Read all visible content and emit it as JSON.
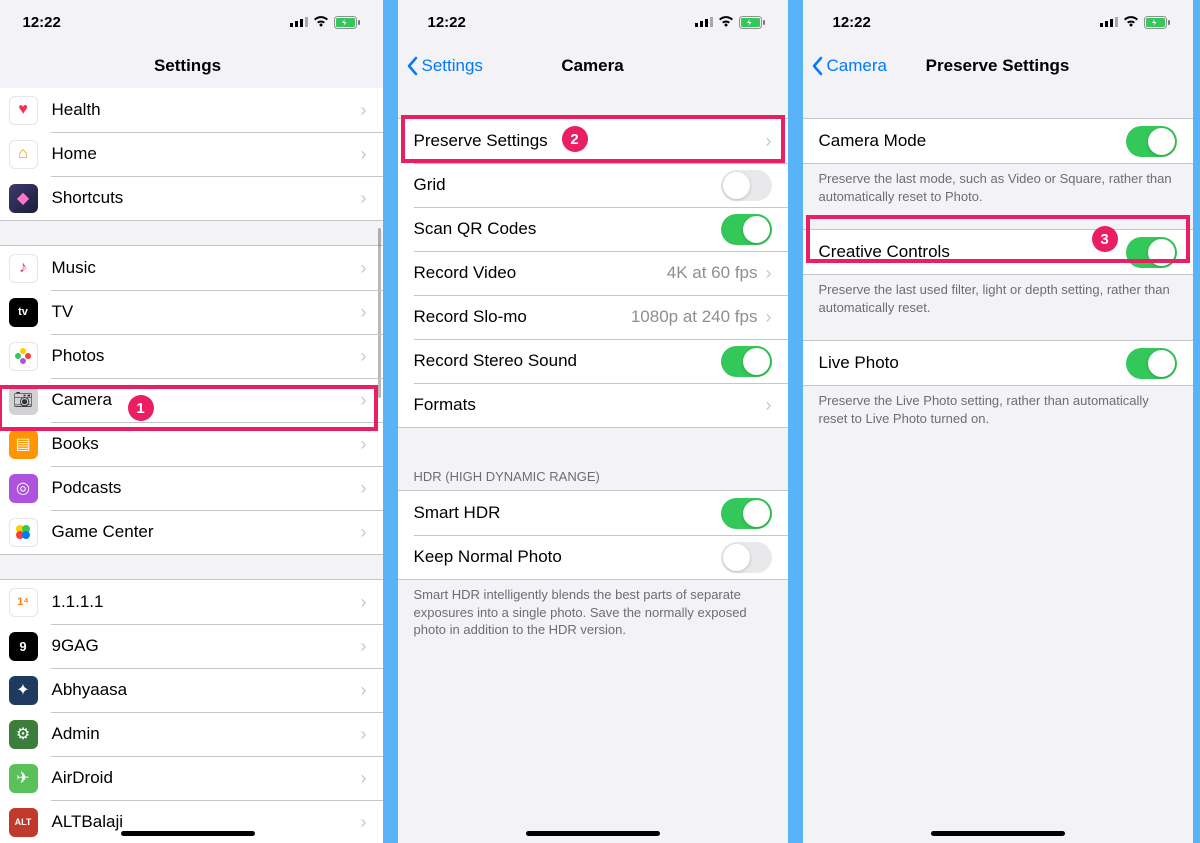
{
  "status": {
    "time": "12:22"
  },
  "badges": {
    "one": "1",
    "two": "2",
    "three": "3"
  },
  "screen1": {
    "title": "Settings",
    "items": [
      {
        "label": "Health"
      },
      {
        "label": "Home"
      },
      {
        "label": "Shortcuts"
      },
      {
        "label": "Music"
      },
      {
        "label": "TV"
      },
      {
        "label": "Photos"
      },
      {
        "label": "Camera"
      },
      {
        "label": "Books"
      },
      {
        "label": "Podcasts"
      },
      {
        "label": "Game Center"
      },
      {
        "label": "1.1.1.1"
      },
      {
        "label": "9GAG"
      },
      {
        "label": "Abhyaasa"
      },
      {
        "label": "Admin"
      },
      {
        "label": "AirDroid"
      },
      {
        "label": "ALTBalaji"
      }
    ]
  },
  "screen2": {
    "back": "Settings",
    "title": "Camera",
    "rows": {
      "preserve": "Preserve Settings",
      "grid": "Grid",
      "scanqr": "Scan QR Codes",
      "recvideo": "Record Video",
      "recvideo_val": "4K at 60 fps",
      "recslomo": "Record Slo-mo",
      "recslomo_val": "1080p at 240 fps",
      "recstereo": "Record Stereo Sound",
      "formats": "Formats"
    },
    "hdr_header": "HDR (HIGH DYNAMIC RANGE)",
    "hdr": {
      "smart": "Smart HDR",
      "keep": "Keep Normal Photo"
    },
    "hdr_footer": "Smart HDR intelligently blends the best parts of separate exposures into a single photo. Save the normally exposed photo in addition to the HDR version."
  },
  "screen3": {
    "back": "Camera",
    "title": "Preserve Settings",
    "rows": {
      "cameramode": "Camera Mode",
      "cameramode_foot": "Preserve the last mode, such as Video or Square, rather than automatically reset to Photo.",
      "creative": "Creative Controls",
      "creative_foot": "Preserve the last used filter, light or depth setting, rather than automatically reset.",
      "livephoto": "Live Photo",
      "livephoto_foot": "Preserve the Live Photo setting, rather than automatically reset to Live Photo turned on."
    }
  }
}
